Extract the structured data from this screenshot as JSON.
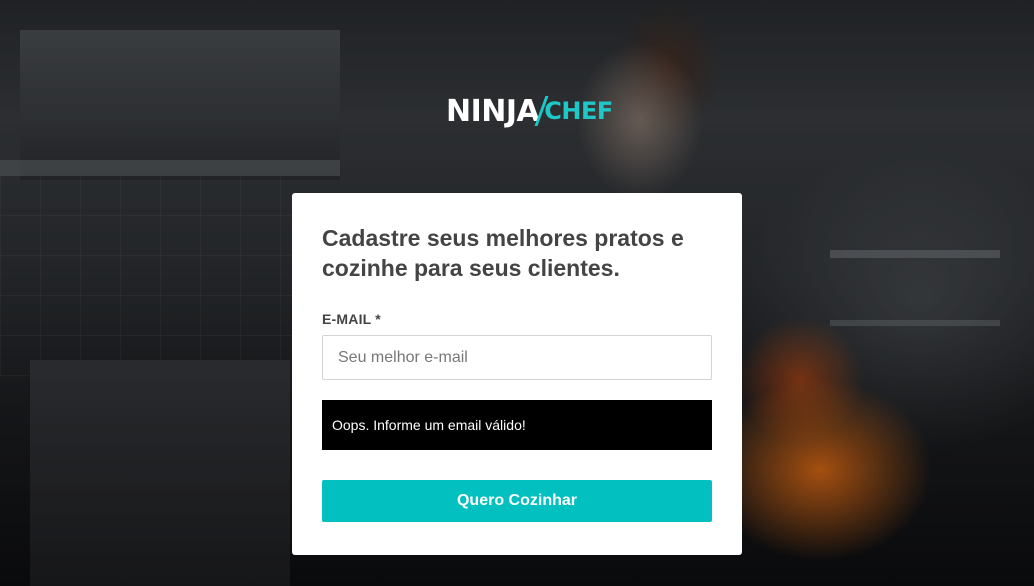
{
  "brand": {
    "logo_part1": "NINJA",
    "logo_part2": "CHEF",
    "accent_color": "#02c0c0"
  },
  "signup": {
    "headline": "Cadastre seus melhores pratos e cozinhe para seus clientes.",
    "email_label": "E-MAIL *",
    "email_value": "",
    "email_placeholder": "Seu melhor e-mail",
    "error_message": "Oops. Informe um email válido!",
    "submit_label": "Quero Cozinhar"
  }
}
